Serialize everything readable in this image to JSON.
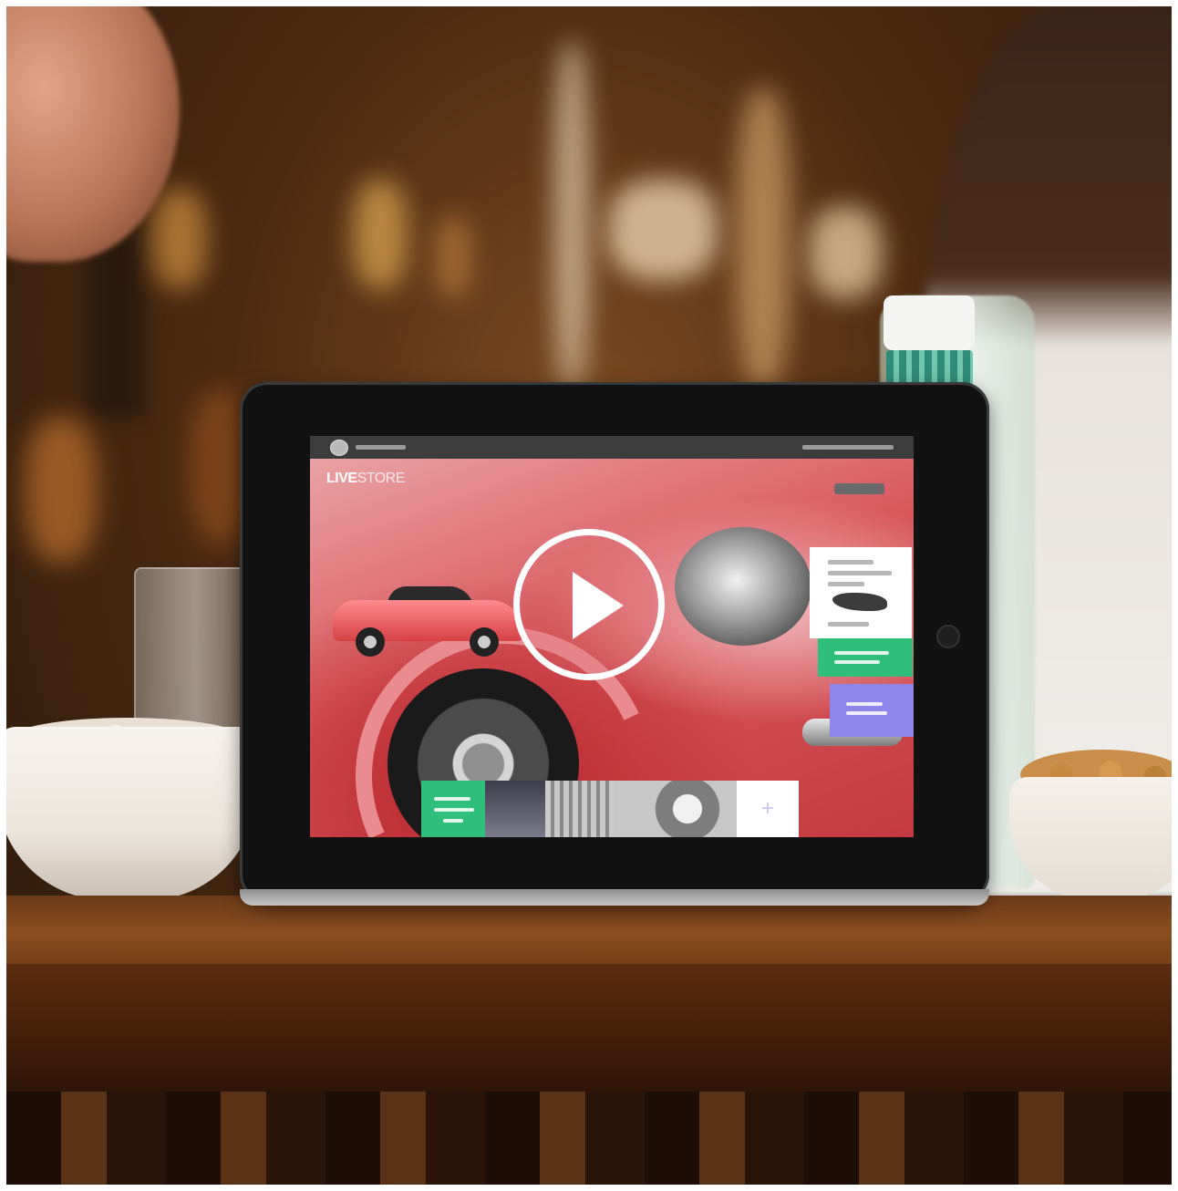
{
  "scene": {
    "description_hidden": "",
    "colors": {
      "table": "#6b3a18",
      "screen_accent": "#d45a5e",
      "button_green": "#2fbf7a",
      "button_purple": "#8f86ea"
    }
  },
  "tablet_app": {
    "logo_prefix": "",
    "logo_live": "LIVE",
    "logo_store": "STORE"
  },
  "video": {
    "play_icon": "play-icon"
  }
}
